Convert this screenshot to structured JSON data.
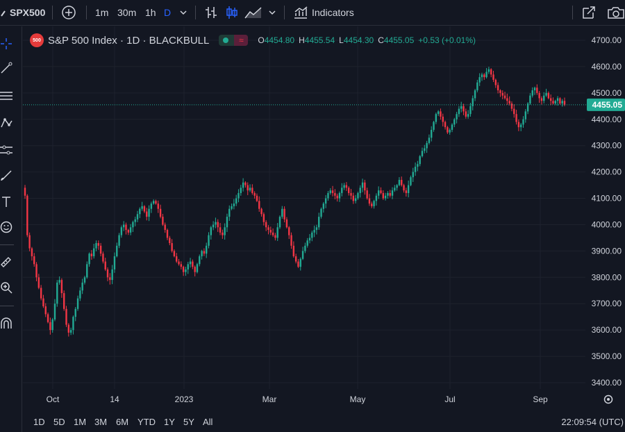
{
  "topbar": {
    "symbol": "SPX500",
    "intervals": [
      "1m",
      "30m",
      "1h",
      "D"
    ],
    "indicators_label": "Indicators"
  },
  "legend": {
    "badge": "500",
    "title": "S&P 500 Index · 1D · BLACKBULL",
    "o_label": "O",
    "o_value": "4454.80",
    "h_label": "H",
    "h_value": "4455.54",
    "l_label": "L",
    "l_value": "4454.30",
    "c_label": "C",
    "c_value": "4455.05",
    "change": "+0.53 (+0.01%)"
  },
  "colors": {
    "up": "#22ab94",
    "down": "#f23645",
    "background": "#131722",
    "grid": "#1e222d"
  },
  "chart_data": {
    "type": "candlestick",
    "y_ticks": [
      "4700.00",
      "4600.00",
      "4500.00",
      "4400.00",
      "4300.00",
      "4200.00",
      "4100.00",
      "4000.00",
      "3900.00",
      "3800.00",
      "3700.00",
      "3600.00",
      "3500.00",
      "3400.00"
    ],
    "ylim": [
      3400,
      4700
    ],
    "x_ticks": [
      "Oct",
      "14",
      "2023",
      "Mar",
      "May",
      "Jul",
      "Sep"
    ],
    "current_price": 4455.05,
    "current_price_label": "4455.05",
    "close": [
      4110,
      3960,
      3910,
      3880,
      3850,
      3800,
      3760,
      3720,
      3690,
      3660,
      3630,
      3600,
      3640,
      3700,
      3780,
      3790,
      3740,
      3680,
      3620,
      3590,
      3600,
      3650,
      3680,
      3720,
      3750,
      3780,
      3800,
      3850,
      3890,
      3880,
      3910,
      3930,
      3920,
      3890,
      3860,
      3830,
      3800,
      3790,
      3830,
      3880,
      3920,
      3960,
      3990,
      4000,
      3980,
      3970,
      3990,
      4010,
      4020,
      4040,
      4060,
      4070,
      4050,
      4030,
      4060,
      4080,
      4090,
      4080,
      4060,
      4030,
      4000,
      3980,
      3950,
      3930,
      3900,
      3880,
      3860,
      3850,
      3840,
      3820,
      3830,
      3850,
      3860,
      3840,
      3820,
      3850,
      3880,
      3900,
      3890,
      3920,
      3960,
      3990,
      4000,
      4010,
      3990,
      3970,
      3960,
      3990,
      4030,
      4060,
      4070,
      4080,
      4100,
      4120,
      4140,
      4160,
      4150,
      4130,
      4140,
      4120,
      4110,
      4090,
      4060,
      4040,
      4010,
      3990,
      3980,
      3970,
      3960,
      3950,
      3990,
      4030,
      4060,
      4020,
      3990,
      3960,
      3920,
      3880,
      3860,
      3840,
      3870,
      3900,
      3920,
      3940,
      3950,
      3970,
      3980,
      3990,
      4030,
      4060,
      4080,
      4100,
      4120,
      4130,
      4120,
      4110,
      4100,
      4120,
      4140,
      4150,
      4140,
      4120,
      4110,
      4090,
      4100,
      4120,
      4140,
      4160,
      4130,
      4100,
      4080,
      4070,
      4090,
      4110,
      4130,
      4120,
      4100,
      4110,
      4120,
      4110,
      4130,
      4140,
      4150,
      4170,
      4150,
      4130,
      4120,
      4150,
      4180,
      4200,
      4220,
      4230,
      4260,
      4280,
      4290,
      4310,
      4330,
      4360,
      4390,
      4420,
      4430,
      4410,
      4390,
      4370,
      4350,
      4360,
      4380,
      4400,
      4420,
      4440,
      4450,
      4430,
      4410,
      4420,
      4450,
      4480,
      4510,
      4540,
      4560,
      4570,
      4560,
      4580,
      4590,
      4570,
      4550,
      4530,
      4510,
      4500,
      4490,
      4480,
      4470,
      4460,
      4440,
      4420,
      4390,
      4370,
      4380,
      4400,
      4430,
      4460,
      4490,
      4510,
      4520,
      4500,
      4480,
      4470,
      4490,
      4500,
      4480,
      4470,
      4460,
      4470,
      4480,
      4460,
      4470,
      4455
    ]
  },
  "bottombar": {
    "ranges": [
      "1D",
      "5D",
      "1M",
      "3M",
      "6M",
      "YTD",
      "1Y",
      "5Y",
      "All"
    ],
    "clock": "22:09:54 (UTC)"
  }
}
